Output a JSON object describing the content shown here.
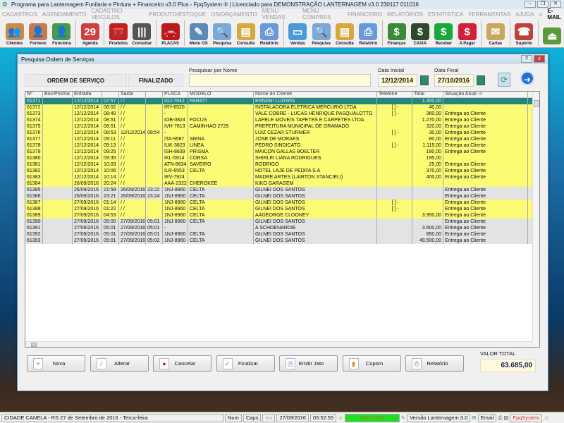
{
  "app": {
    "title": "Programa para Lanternagem Funilaria e Pintura + Financeiro v3.0 Plus - FpqSystem ® | Licenciado para  DEMONSTRAÇÃO LANTERNAGEM v3.0 230117 011016"
  },
  "menu": [
    "CADASTROS",
    "AGENDAMENTO",
    "CADASTRO VEICULOS",
    "PRODUTO/ESTOQUE",
    "OS/ORÇAMENTO",
    "MENU VENDAS",
    "MENU COMPRAS",
    "FINANCEIRO",
    "RELATÓRIOS",
    "ESTATISTICA",
    "FERRAMENTAS",
    "AJUDA"
  ],
  "menu_email": "E-MAIL",
  "toolbar": [
    {
      "label": "Clientes",
      "icon": "clients-icon",
      "color": "#c98a4a",
      "g": "👥"
    },
    {
      "label": "Fornece",
      "icon": "supplier-icon",
      "color": "#c97a4a",
      "g": "👤"
    },
    {
      "label": "Funciona",
      "icon": "employee-icon",
      "color": "#4a9a4a",
      "g": "👤"
    },
    {
      "sep": true
    },
    {
      "label": "Agenda",
      "icon": "calendar-icon",
      "color": "#d04040",
      "g": "29"
    },
    {
      "sep": true
    },
    {
      "label": "Produtos",
      "icon": "toolbox-icon",
      "color": "#c02020",
      "g": "🧰"
    },
    {
      "label": "Consultar",
      "icon": "barcode-icon",
      "color": "#555",
      "g": "|||"
    },
    {
      "sep": true
    },
    {
      "label": "PLACAS",
      "icon": "car-icon",
      "color": "#c01818",
      "g": "🚗"
    },
    {
      "sep": true
    },
    {
      "label": "Menu OS",
      "icon": "clipboard-icon",
      "color": "#5a8ab8",
      "g": "✎"
    },
    {
      "label": "Pesquisa",
      "icon": "search-doc-icon",
      "color": "#7aa8d8",
      "g": "🔍"
    },
    {
      "label": "Consulta",
      "icon": "folder-icon",
      "color": "#d8a840",
      "g": "▤"
    },
    {
      "label": "Relatório",
      "icon": "printer-icon",
      "color": "#6a98d8",
      "g": "⎙"
    },
    {
      "sep": true
    },
    {
      "label": "Vendas",
      "icon": "monitor-icon",
      "color": "#4a9ad8",
      "g": "▭"
    },
    {
      "label": "Pesquisa",
      "icon": "search-doc-icon",
      "color": "#7aa8d8",
      "g": "🔍"
    },
    {
      "label": "Consulta",
      "icon": "folder-icon",
      "color": "#d8a840",
      "g": "▤"
    },
    {
      "label": "Relatório",
      "icon": "printer-icon",
      "color": "#6a98d8",
      "g": "⎙"
    },
    {
      "sep": true
    },
    {
      "label": "Finanças",
      "icon": "finance-icon",
      "color": "#3a8a3a",
      "g": "$"
    },
    {
      "label": "CAIXA",
      "icon": "cashbook-icon",
      "color": "#2a4a2a",
      "g": "$"
    },
    {
      "label": "Receber",
      "icon": "receive-icon",
      "color": "#1aa83a",
      "g": "$"
    },
    {
      "label": "A Pagar",
      "icon": "pay-icon",
      "color": "#d0203a",
      "g": "$"
    },
    {
      "sep": true
    },
    {
      "label": "Cartas",
      "icon": "scroll-icon",
      "color": "#c8a860",
      "g": "✉"
    },
    {
      "sep": true
    },
    {
      "label": "Suporte",
      "icon": "support-icon",
      "color": "#c04040",
      "g": "☎"
    },
    {
      "sep": true
    },
    {
      "label": "",
      "icon": "exit-icon",
      "color": "#5a9a3a",
      "g": "⏏"
    }
  ],
  "dialog": {
    "title": "Pesquisa Ordem de Serviços",
    "help": "?",
    "close": "x",
    "section_label": "ORDEM DE SERVIÇO",
    "status_label": "FINALIZADO",
    "search_label": "Pesquisar por Nome",
    "search_value": "",
    "date_start_label": "Data Inicial",
    "date_start": "12/12/2014",
    "date_end_label": "Data Final",
    "date_end": "27/10/2016",
    "columns": [
      "Nº",
      "Box/Prisma",
      "Entrada",
      "",
      "Saida",
      "",
      "PLACA",
      "MODELO",
      "Nome do Cliente",
      "Telefone",
      "Total",
      "Situação Atual ->"
    ],
    "rows": [
      [
        "61371",
        "",
        "12/12/2014",
        "07:57",
        " / /",
        "",
        "IGJ-7642",
        "PARATI",
        "ERNANI LUDWIG",
        "",
        "1.400,00",
        "",
        "sel"
      ],
      [
        "61372",
        "",
        "12/12/2014",
        "08:02",
        " / /",
        "",
        "IRY-6520",
        "",
        "INSTALADORA ELETRICA MERCURIO LTDA",
        "[ ]   -",
        "40,00",
        "",
        "yellow"
      ],
      [
        "61373",
        "",
        "12/12/2014",
        "08:49",
        " / /",
        "",
        "-",
        "",
        "VALE COBRE - LUCAS HENRIQUE PASQUALOTTO",
        "[ ]   -",
        "360,00",
        "Entrega ao Cliente",
        "yellow"
      ],
      [
        "61374",
        "",
        "12/12/2014",
        "08:51",
        " / /",
        "",
        "IOB-0824",
        "FOCUS",
        "LAPELE MÓVEIS TAPETES E CARPETES LTDA",
        "",
        "1.270,00",
        "Entrega ao Cliente",
        "yellow"
      ],
      [
        "61375",
        "",
        "12/12/2014",
        "08:51",
        " / /",
        "",
        "IVH-7613",
        "CAMINHAO 2729",
        "PREFEITURA MUNICIPAL DE GRAMADO",
        "",
        "320,00",
        "Entrega ao Cliente",
        "yellow"
      ],
      [
        "61376",
        "",
        "12/12/2014",
        "08:53",
        "12/12/2014",
        "08:54",
        "-",
        "",
        "LUIZ CEZAR STURMER",
        "[ ]   -",
        "30,00",
        "Entrega ao Cliente",
        "yellow"
      ],
      [
        "61377",
        "",
        "12/12/2014",
        "09:11",
        " / /",
        "",
        "ITA-9587",
        "SIENA",
        "JOSE DE MORAES",
        "",
        "80,00",
        "Entrega ao Cliente",
        "yellow"
      ],
      [
        "61378",
        "",
        "12/12/2014",
        "09:13",
        " / /",
        "",
        "IUK-3823",
        "LINEA",
        "PEDRO SINDICATO",
        "[ ]   -",
        "1.115,00",
        "Entrega ao Cliente",
        "yellow"
      ],
      [
        "61379",
        "",
        "12/12/2014",
        "09:25",
        " / /",
        "",
        "ISH-8839",
        "PRISMA",
        "MAICON GALLAS BOELTER",
        "",
        "180,00",
        "Entrega ao Cliente",
        "yellow"
      ],
      [
        "61380",
        "",
        "12/12/2014",
        "09:35",
        " / /",
        "",
        "IKL-5914",
        "CORSA",
        "SHIRLEI LIANA RODRIGUES",
        "",
        "195,00",
        "",
        "yellow"
      ],
      [
        "61381",
        "",
        "12/12/2014",
        "10:03",
        " / /",
        "",
        "ATN-8634",
        "SAVEIRO",
        "RODRIGO",
        "",
        "25,00",
        "Entrega ao Cliente",
        "yellow"
      ],
      [
        "61382",
        "",
        "12/12/2014",
        "10:06",
        " / /",
        "",
        "ILR-6553",
        "CELTA",
        "HOTEL LAJE DE PEDRA S.A",
        "",
        "370,00",
        "Entrega ao Cliente",
        "yellow"
      ],
      [
        "61383",
        "",
        "12/12/2014",
        "10:14",
        " / /",
        "",
        "IEV-7924",
        "",
        "MADRE ARTES (LAIRTON STANCIELI)",
        "",
        "400,00",
        "Entrega ao Cliente",
        "yellow"
      ],
      [
        "61384",
        "",
        "26/09/2016",
        "20:24",
        " / /",
        "",
        "AAA-2322",
        "CHEROKEE",
        "KIKO GARAGEM",
        "",
        "",
        "",
        "yellow"
      ],
      [
        "61385",
        "",
        "26/09/2016",
        "21:58",
        "26/09/2016",
        "23:22",
        "1NJ-8960",
        "CELTA",
        "GILNEI DOS SANTOS",
        "",
        "",
        "Entrega ao Cliente",
        "gray"
      ],
      [
        "61386",
        "",
        "26/09/2016",
        "23:21",
        "26/09/2016",
        "23:24",
        "1NJ-8960",
        "CELTA",
        "GILNEI DOS SANTOS",
        "",
        "",
        "Entrega ao Cliente",
        "gray"
      ],
      [
        "61387",
        "",
        "27/09/2016",
        "01:14",
        " / /",
        "",
        "1NJ-8960",
        "CELTA",
        "GILNEI DOS SANTOS",
        "[ ]   -",
        "",
        "Entrega ao Cliente",
        "yellow"
      ],
      [
        "61388",
        "",
        "27/09/2016",
        "01:22",
        " / /",
        "",
        "1NJ-8960",
        "CELTA",
        "GILNEI DOS SANTOS",
        "[ ]   -",
        "",
        "Entrega ao Cliente",
        "yellow"
      ],
      [
        "61389",
        "",
        "27/09/2016",
        "04:53",
        " / /",
        "",
        "1NJ-8960",
        "CELTA",
        "AAGEORGE CLOONEY",
        "",
        "3.950,00",
        "Entrega ao Cliente",
        "yellow"
      ],
      [
        "61390",
        "",
        "27/09/2016",
        "05:00",
        "27/09/2016",
        "05:01",
        "1NJ-8960",
        "CELTA",
        "GILNEI DOS SANTOS",
        "",
        "",
        "Entrega ao Cliente",
        "gray"
      ],
      [
        "61391",
        "",
        "27/09/2016",
        "05:01",
        "27/09/2016",
        "05:01",
        "-",
        "",
        "A SCHOENARDIE",
        "",
        "3.600,00",
        "Entrega ao Cliente",
        "gray"
      ],
      [
        "61392",
        "",
        "27/09/2016",
        "05:01",
        "27/09/2016",
        "05:01",
        "1NJ-8960",
        "CELTA",
        "GILNEI DOS SANTOS",
        "",
        "850,00",
        "Entrega ao Cliente",
        "gray"
      ],
      [
        "61393",
        "",
        "27/09/2016",
        "05:01",
        "27/09/2016",
        "05:02",
        "1NJ-8960",
        "CELTA",
        "GILNEI DOS SANTOS",
        "",
        "49.500,00",
        "Entrega ao Cliente",
        "gray"
      ]
    ],
    "buttons": [
      {
        "label": "Nova",
        "icon": "new-doc-icon",
        "g": "+",
        "c": "#2a9a3a"
      },
      {
        "label": "Alterar",
        "icon": "pencil-icon",
        "g": "/",
        "c": "#b08a30"
      },
      {
        "label": "Cancelar",
        "icon": "cancel-doc-icon",
        "g": "●",
        "c": "#c02020"
      },
      {
        "label": "Finalizar",
        "icon": "check-doc-icon",
        "g": "✓",
        "c": "#2a9a3a"
      },
      {
        "label": "Emitir Jato",
        "icon": "printer-icon",
        "g": "⎙",
        "c": "#4a7ab8"
      },
      {
        "label": "Cupom",
        "icon": "receipt-icon",
        "g": "▮",
        "c": "#e08a20"
      },
      {
        "label": "Relatório",
        "icon": "printer-icon",
        "g": "⎙",
        "c": "#4a7ab8"
      }
    ],
    "total_label": "VALOR TOTAL",
    "total_value": "63.685,00"
  },
  "statusbar": {
    "location": "CIDADE CANELA - RS 27 de Setembro de 2016 - Terca-feira",
    "num": "Num",
    "caps": "Caps",
    "ins": "Ins",
    "date": "27/09/2016",
    "time": "05:52:55",
    "user": "MASTER",
    "version": "Versão Lanternagem 3.0",
    "email": "Email",
    "brand": "FpqSystem"
  }
}
